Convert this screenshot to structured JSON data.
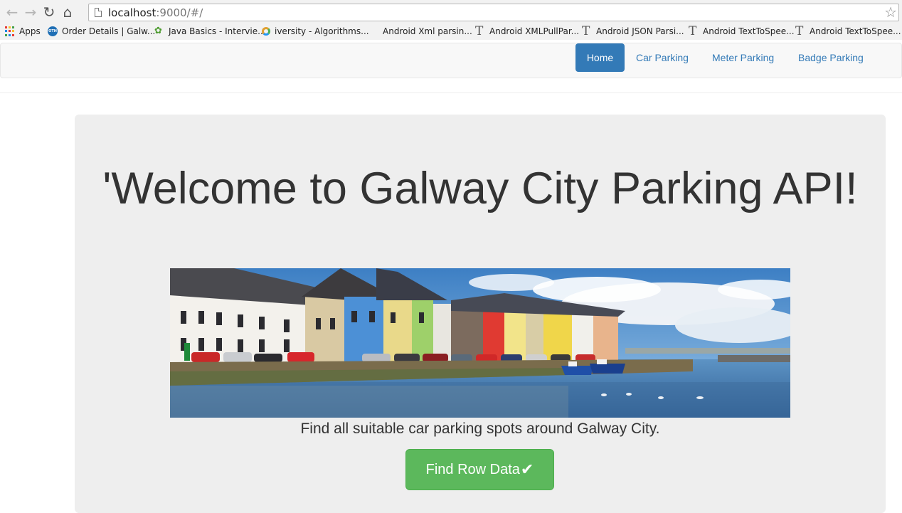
{
  "browser": {
    "url_host": "localhost",
    "url_rest": ":9000/#/",
    "back_icon": "back-arrow-icon",
    "forward_icon": "forward-arrow-icon",
    "reload_icon": "reload-icon",
    "home_icon": "home-icon",
    "star_icon": "bookmark-star-icon"
  },
  "bookmarks": [
    {
      "label": "Apps",
      "icon": "apps-grid-icon"
    },
    {
      "label": "Order Details | Galw...",
      "icon": "oth-icon"
    },
    {
      "label": "Java Basics - Intervie...",
      "icon": "leaf-icon"
    },
    {
      "label": "iversity - Algorithms...",
      "icon": "ring-icon"
    },
    {
      "label": "Android Xml parsin...",
      "icon": "none"
    },
    {
      "label": "Android XMLPullPar...",
      "icon": "t-icon"
    },
    {
      "label": "Android JSON Parsi...",
      "icon": "t-icon"
    },
    {
      "label": "Android TextToSpee...",
      "icon": "t-icon"
    },
    {
      "label": "Android TextToSpee...",
      "icon": "t-icon"
    }
  ],
  "navbar": {
    "items": [
      {
        "label": "Home",
        "active": true
      },
      {
        "label": "Car Parking",
        "active": false
      },
      {
        "label": "Meter Parking",
        "active": false
      },
      {
        "label": "Badge Parking",
        "active": false
      }
    ],
    "active_color": "#337ab7",
    "link_color": "#337ab7"
  },
  "jumbotron": {
    "headline": "'Welcome to Galway City Parking API!",
    "tagline": "Find all suitable car parking spots around Galway City.",
    "button_label": "Find Row Data",
    "button_icon": "check-icon",
    "button_color": "#5cb85c",
    "image": "galway-harbour-colorful-houses-photo"
  }
}
